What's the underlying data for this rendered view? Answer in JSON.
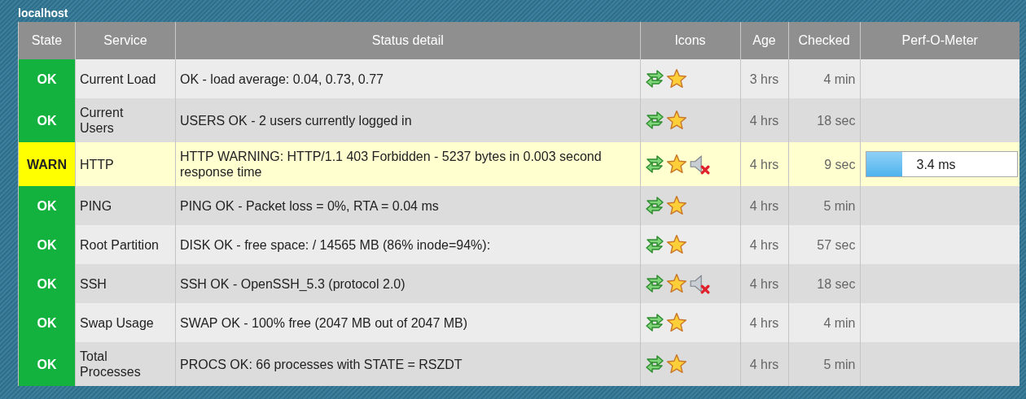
{
  "host": "localhost",
  "columns": [
    "State",
    "Service",
    "Status detail",
    "Icons",
    "Age",
    "Checked",
    "Perf-O-Meter"
  ],
  "rows": [
    {
      "state": "OK",
      "kind": "ok",
      "service": "Current Load",
      "detail": "OK - load average: 0.04, 0.73, 0.77",
      "notifications_muted": false,
      "age": "3 hrs",
      "checked": "4 min"
    },
    {
      "state": "OK",
      "kind": "ok",
      "service": "Current Users",
      "detail": "USERS OK - 2 users currently logged in",
      "notifications_muted": false,
      "age": "4 hrs",
      "checked": "18 sec"
    },
    {
      "state": "WARN",
      "kind": "warn",
      "service": "HTTP",
      "detail": "HTTP WARNING: HTTP/1.1 403 Forbidden - 5237 bytes in 0.003 second response time",
      "notifications_muted": true,
      "age": "4 hrs",
      "checked": "9 sec",
      "perf": {
        "level": 0.24,
        "reading": "3.4 ms"
      }
    },
    {
      "state": "OK",
      "kind": "ok",
      "service": "PING",
      "detail": "PING OK - Packet loss = 0%, RTA = 0.04 ms",
      "notifications_muted": false,
      "age": "4 hrs",
      "checked": "5 min"
    },
    {
      "state": "OK",
      "kind": "ok",
      "service": "Root Partition",
      "detail": "DISK OK - free space: / 14565 MB (86% inode=94%):",
      "notifications_muted": false,
      "age": "4 hrs",
      "checked": "57 sec"
    },
    {
      "state": "OK",
      "kind": "ok",
      "service": "SSH",
      "detail": "SSH OK - OpenSSH_5.3 (protocol 2.0)",
      "notifications_muted": true,
      "age": "4 hrs",
      "checked": "18 sec"
    },
    {
      "state": "OK",
      "kind": "ok",
      "service": "Swap Usage",
      "detail": "SWAP OK - 100% free (2047 MB out of 2047 MB)",
      "notifications_muted": false,
      "age": "4 hrs",
      "checked": "4 min"
    },
    {
      "state": "OK",
      "kind": "ok",
      "service": "Total Processes",
      "detail": "PROCS OK: 66 processes with STATE = RSZDT",
      "notifications_muted": false,
      "age": "4 hrs",
      "checked": "5 min"
    }
  ]
}
